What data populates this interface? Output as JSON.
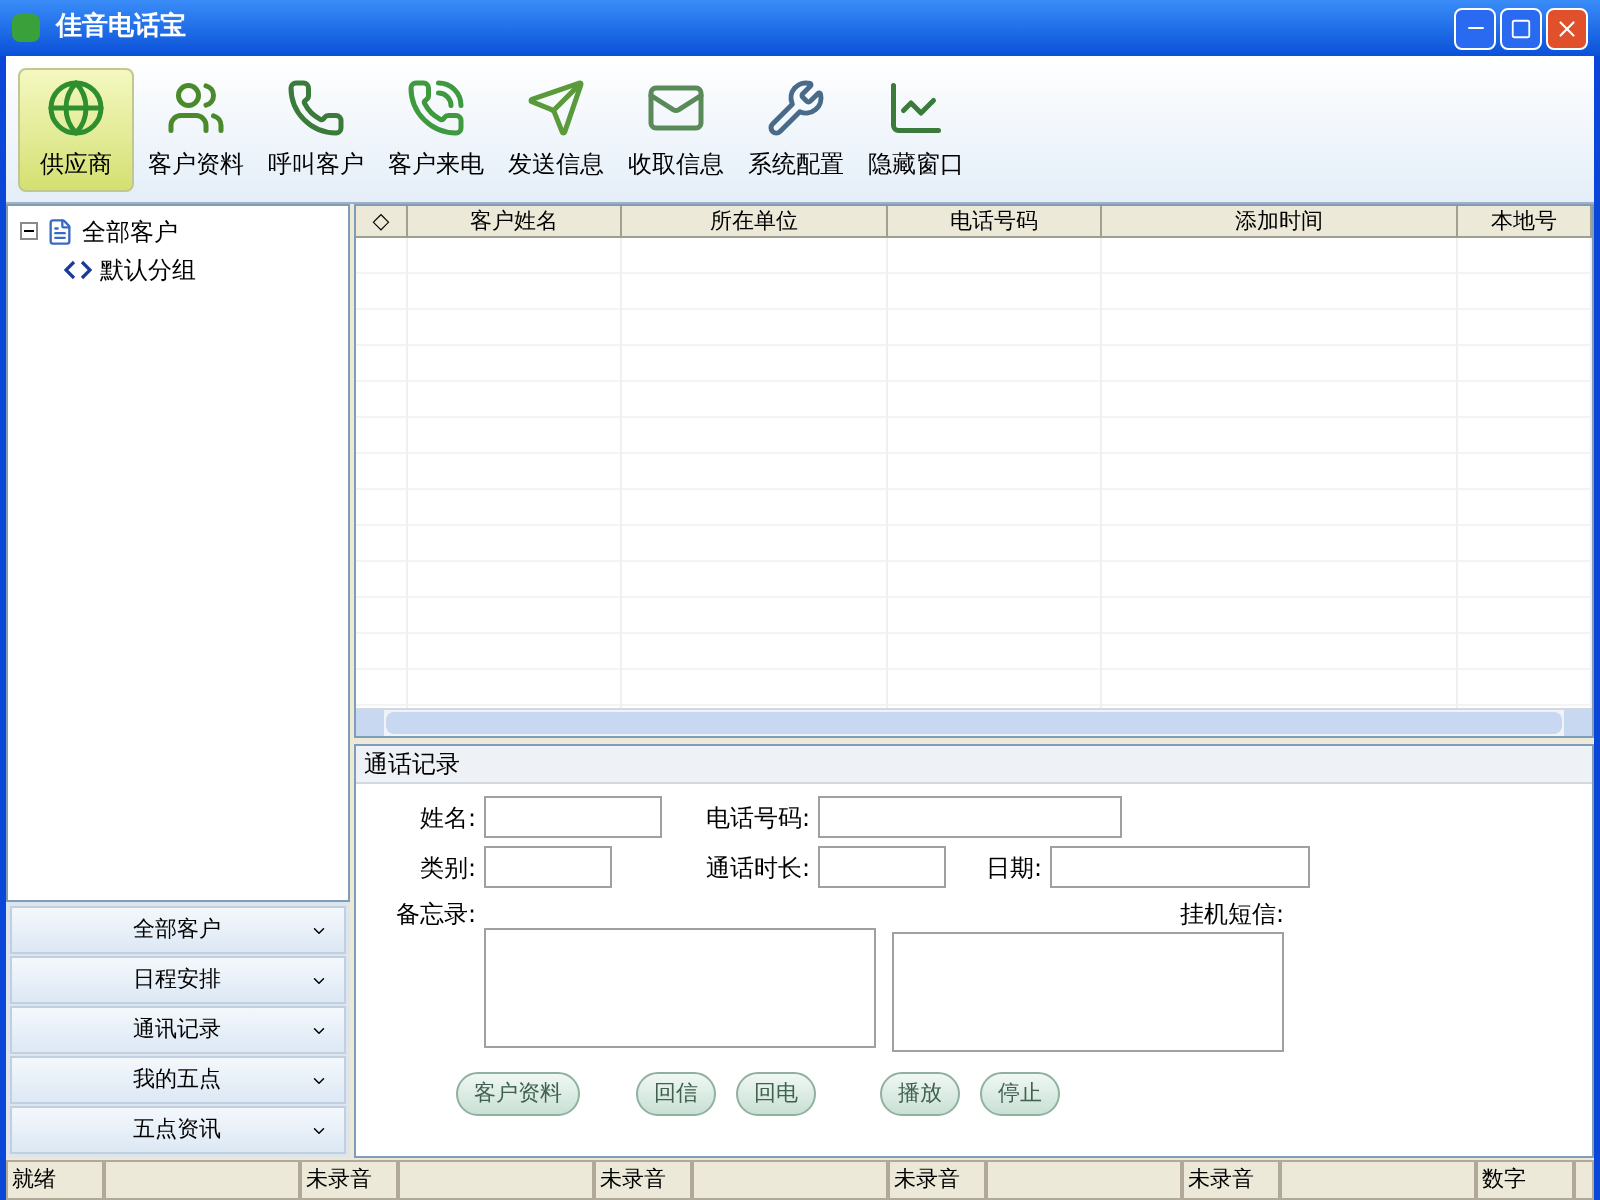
{
  "window": {
    "title": "佳音电话宝"
  },
  "toolbar": [
    {
      "label": "供应商",
      "selected": true
    },
    {
      "label": "客户资料",
      "selected": false
    },
    {
      "label": "呼叫客户",
      "selected": false
    },
    {
      "label": "客户来电",
      "selected": false
    },
    {
      "label": "发送信息",
      "selected": false
    },
    {
      "label": "收取信息",
      "selected": false
    },
    {
      "label": "系统配置",
      "selected": false
    },
    {
      "label": "隐藏窗口",
      "selected": false
    }
  ],
  "tree": [
    {
      "label": "全部客户",
      "expanded": true,
      "children": [
        {
          "label": "默认分组"
        }
      ]
    }
  ],
  "nav_buttons": [
    "全部客户",
    "日程安排",
    "通讯记录",
    "我的五点",
    "五点资讯"
  ],
  "table": {
    "columns": [
      "◇",
      "客户姓名",
      "所在单位",
      "电话号码",
      "添加时间",
      "本地号"
    ]
  },
  "call_record": {
    "title": "通话记录",
    "fields": {
      "name": "姓名:",
      "phone": "电话号码:",
      "category": "类别:",
      "duration": "通话时长:",
      "date": "日期:",
      "memo": "备忘录:",
      "sms": "挂机短信:"
    },
    "buttons": [
      "客户资料",
      "回信",
      "回电",
      "播放",
      "停止"
    ]
  },
  "status_bar": [
    "就绪",
    "未录音",
    "未录音",
    "未录音",
    "未录音",
    "数字"
  ]
}
